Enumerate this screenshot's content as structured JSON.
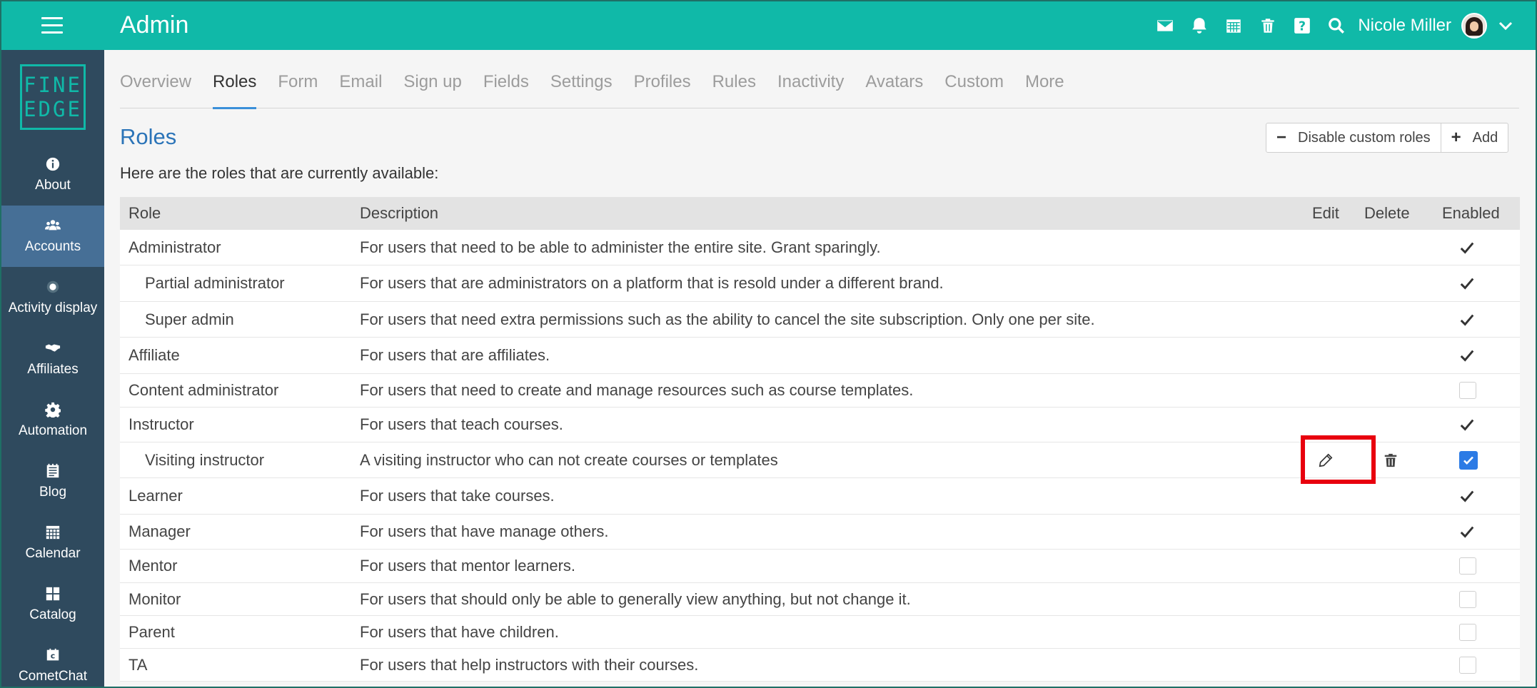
{
  "header": {
    "title": "Admin",
    "user_name": "Nicole Miller",
    "icons": [
      "mail-icon",
      "bell-icon",
      "calendar-icon",
      "trash-icon",
      "help-icon",
      "search-icon"
    ]
  },
  "sidebar": {
    "logo_line1": "FINE",
    "logo_line2": "EDGE",
    "items": [
      {
        "label": "About",
        "icon": "info-icon"
      },
      {
        "label": "Accounts",
        "icon": "users-icon",
        "active": true
      },
      {
        "label": "Activity display",
        "icon": "dot-icon"
      },
      {
        "label": "Affiliates",
        "icon": "handshake-icon"
      },
      {
        "label": "Automation",
        "icon": "gear-icon"
      },
      {
        "label": "Blog",
        "icon": "blog-icon"
      },
      {
        "label": "Calendar",
        "icon": "calendar-icon"
      },
      {
        "label": "Catalog",
        "icon": "catalog-icon"
      },
      {
        "label": "CometChat",
        "icon": "chat-icon"
      }
    ]
  },
  "tabs": [
    "Overview",
    "Roles",
    "Form",
    "Email",
    "Sign up",
    "Fields",
    "Settings",
    "Profiles",
    "Rules",
    "Inactivity",
    "Avatars",
    "Custom",
    "More"
  ],
  "active_tab": "Roles",
  "page": {
    "title": "Roles",
    "intro": "Here are the roles that are currently available:",
    "disable_label": "Disable custom roles",
    "add_label": "Add"
  },
  "table": {
    "headers": {
      "role": "Role",
      "description": "Description",
      "edit": "Edit",
      "delete": "Delete",
      "enabled": "Enabled"
    },
    "rows": [
      {
        "role": "Administrator",
        "description": "For users that need to be able to administer the entire site. Grant sparingly.",
        "enabled": "check"
      },
      {
        "role": "Partial administrator",
        "description": "For users that are administrators on a platform that is resold under a different brand.",
        "enabled": "check"
      },
      {
        "role": "Super admin",
        "description": "For users that need extra permissions such as the ability to cancel the site subscription. Only one per site.",
        "enabled": "check"
      },
      {
        "role": "Affiliate",
        "description": "For users that are affiliates.",
        "enabled": "check"
      },
      {
        "role": "Content administrator",
        "description": "For users that need to create and manage resources such as course templates.",
        "enabled": "box"
      },
      {
        "role": "Instructor",
        "description": "For users that teach courses.",
        "enabled": "check"
      },
      {
        "role": "Visiting instructor",
        "description": "A visiting instructor who can not create courses or templates",
        "enabled": "checkbox-checked"
      },
      {
        "role": "Learner",
        "description": "For users that take courses.",
        "enabled": "check"
      },
      {
        "role": "Manager",
        "description": "For users that have manage others.",
        "enabled": "check"
      },
      {
        "role": "Mentor",
        "description": "For users that mentor learners.",
        "enabled": "box"
      },
      {
        "role": "Monitor",
        "description": "For users that should only be able to generally view anything, but not change it.",
        "enabled": "box"
      },
      {
        "role": "Parent",
        "description": "For users that have children.",
        "enabled": "box"
      },
      {
        "role": "TA",
        "description": "For users that help instructors with their courses.",
        "enabled": "box"
      }
    ]
  },
  "highlight_color": "#e8000e",
  "accent_color": "#10b9a8"
}
